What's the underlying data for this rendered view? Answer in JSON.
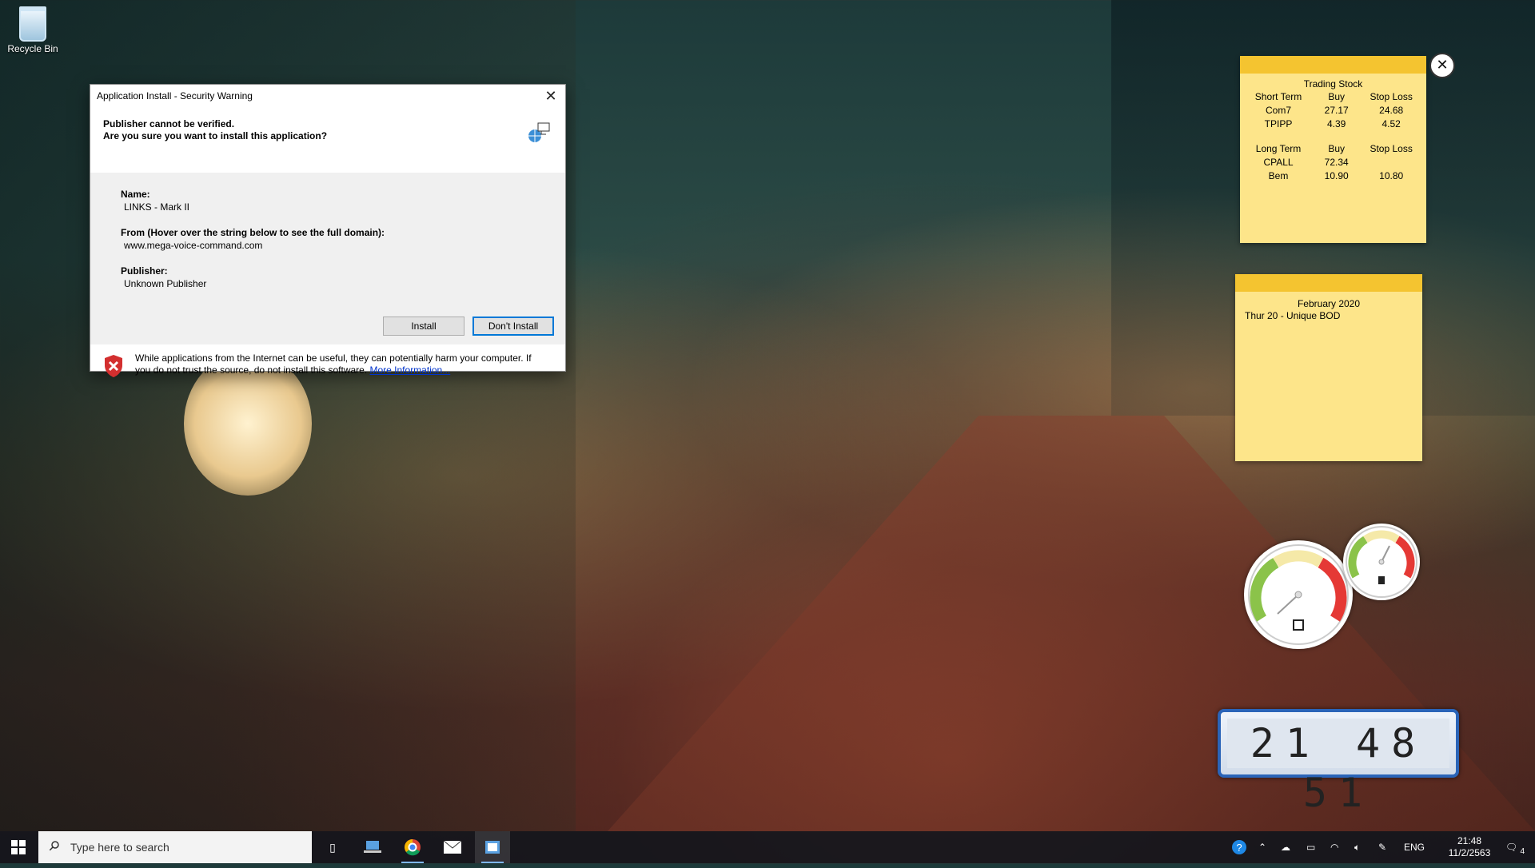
{
  "desktop": {
    "recycle_bin_label": "Recycle Bin"
  },
  "dialog": {
    "title": "Application Install - Security Warning",
    "heading_line1": "Publisher cannot be verified.",
    "heading_line2": "Are you sure you want to install this application?",
    "name_label": "Name:",
    "name_value": "LINKS - Mark II",
    "from_label": "From (Hover over the string below to see the full domain):",
    "from_value": "www.mega-voice-command.com",
    "publisher_label": "Publisher:",
    "publisher_value": "Unknown Publisher",
    "install_button": "Install",
    "dont_install_button": "Don't Install",
    "warning_text": "While applications from the Internet can be useful, they can potentially harm your computer. If you do not trust the source, do not install this software.",
    "more_info_link": "More Information..."
  },
  "stock_note": {
    "title": "Trading Stock",
    "short_header": [
      "Short Term",
      "Buy",
      "Stop Loss"
    ],
    "short_rows": [
      [
        "Com7",
        "27.17",
        "24.68"
      ],
      [
        "TPIPP",
        "4.39",
        "4.52"
      ]
    ],
    "long_header": [
      "Long Term",
      "Buy",
      "Stop Loss"
    ],
    "long_rows": [
      [
        "CPALL",
        "72.34",
        ""
      ],
      [
        "Bem",
        "10.90",
        "10.80"
      ]
    ]
  },
  "calendar_note": {
    "title": "February 2020",
    "entry": "Thur 20 - Unique BOD"
  },
  "clock": {
    "time": "21 48 51"
  },
  "taskbar": {
    "search_placeholder": "Type here to search",
    "language": "ENG",
    "time": "21:48",
    "date": "11/2/2563",
    "notification_count": "4"
  },
  "colors": {
    "accent": "#0078d7",
    "note_yellow": "#fde58a",
    "note_bar": "#f4c430",
    "taskbar": "#14161c"
  }
}
